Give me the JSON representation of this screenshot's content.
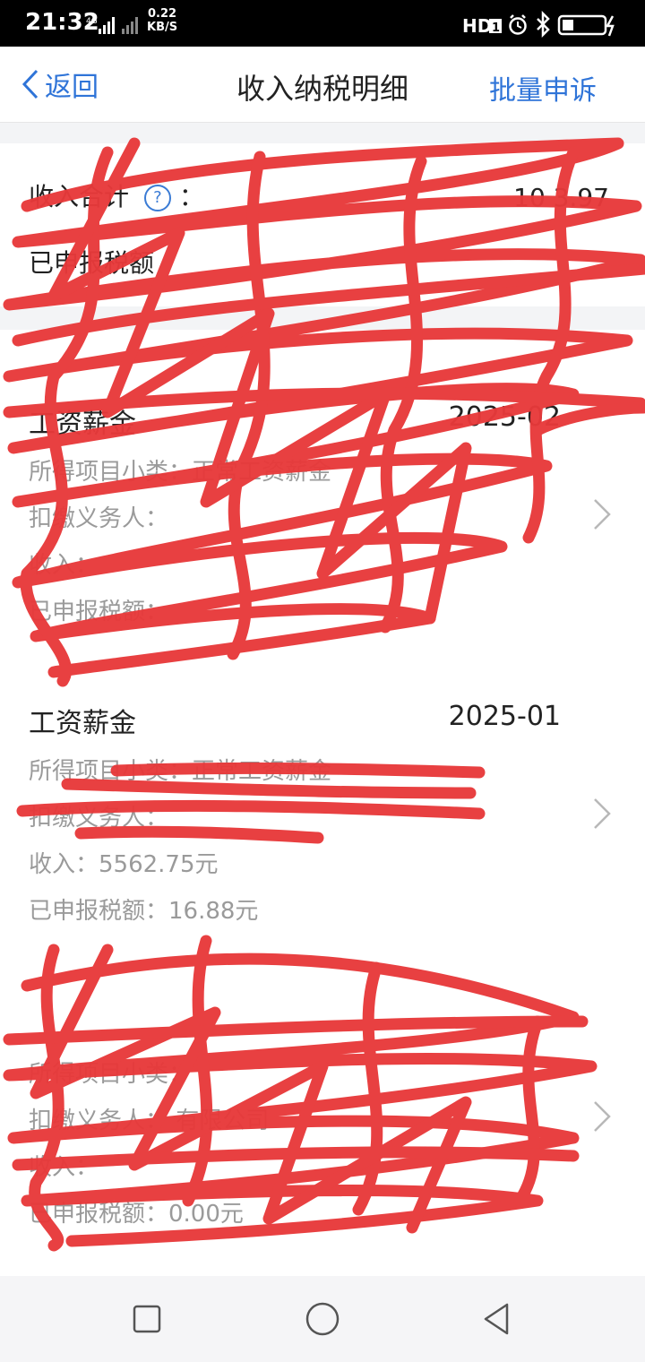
{
  "status_bar": {
    "time": "21:32",
    "network": "4G",
    "speed_value": "0.22",
    "speed_unit": "KB/S",
    "hd_label": "HD",
    "hd_num": "1"
  },
  "nav": {
    "back_label": "返回",
    "title": "收入纳税明细",
    "batch_appeal_label": "批量申诉"
  },
  "summary": {
    "income_label": "收入合计",
    "declared_label": "已申报税额",
    "income_value_partial": "10  3.97"
  },
  "records": [
    {
      "title": "工资薪金",
      "date": "2025-02",
      "subcategory": "所得项目小类：正常工资薪金",
      "withholder": "扣缴义务人：",
      "income": "收入：",
      "declared_tax": "已申报税额："
    },
    {
      "title": "工资薪金",
      "date": "2025-01",
      "subcategory": "所得项目小类：正常工资薪金",
      "withholder": "扣缴义务人：",
      "income": "收入：5562.75元",
      "declared_tax": "已申报税额：16.88元"
    },
    {
      "title": "",
      "date": "",
      "subcategory": "所得项目小类：",
      "withholder": "扣缴义务人：  有限公司",
      "income": "收入：",
      "declared_tax": "已申报税额：0.00元"
    }
  ],
  "colors": {
    "accent": "#2f74d8",
    "scribble": "#e8393a",
    "secondary_text": "#9a9a9a"
  },
  "icons": [
    "chevron-left-icon",
    "help-circle-icon",
    "chevron-right-icon",
    "square-icon",
    "circle-icon",
    "triangle-back-icon"
  ]
}
